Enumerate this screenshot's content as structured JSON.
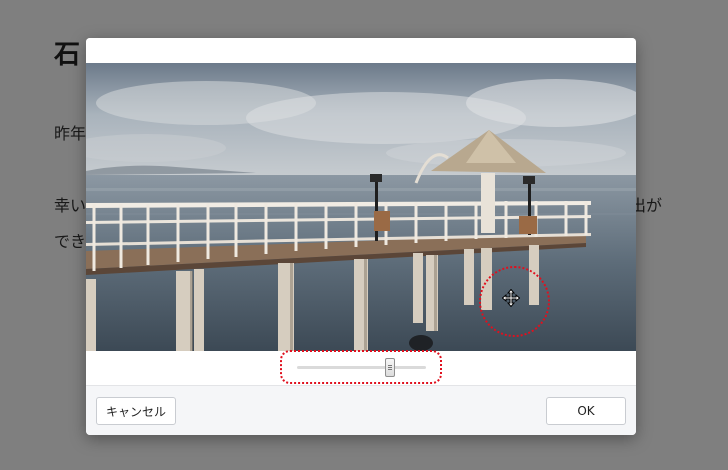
{
  "article": {
    "title": "石",
    "para1": "昨年",
    "para2_start": "幸い",
    "para2_end": "出が",
    "para3": "でき"
  },
  "dialog": {
    "photo_alt": "Pier over the ocean with a thatched gazebo",
    "zoom_level": 0.72,
    "cancel_label": "キャンセル",
    "ok_label": "OK"
  },
  "colors": {
    "highlight": "#e0101e",
    "footer_bg": "#f5f6f8",
    "overlay": "rgba(0,0,0,0.5)"
  }
}
